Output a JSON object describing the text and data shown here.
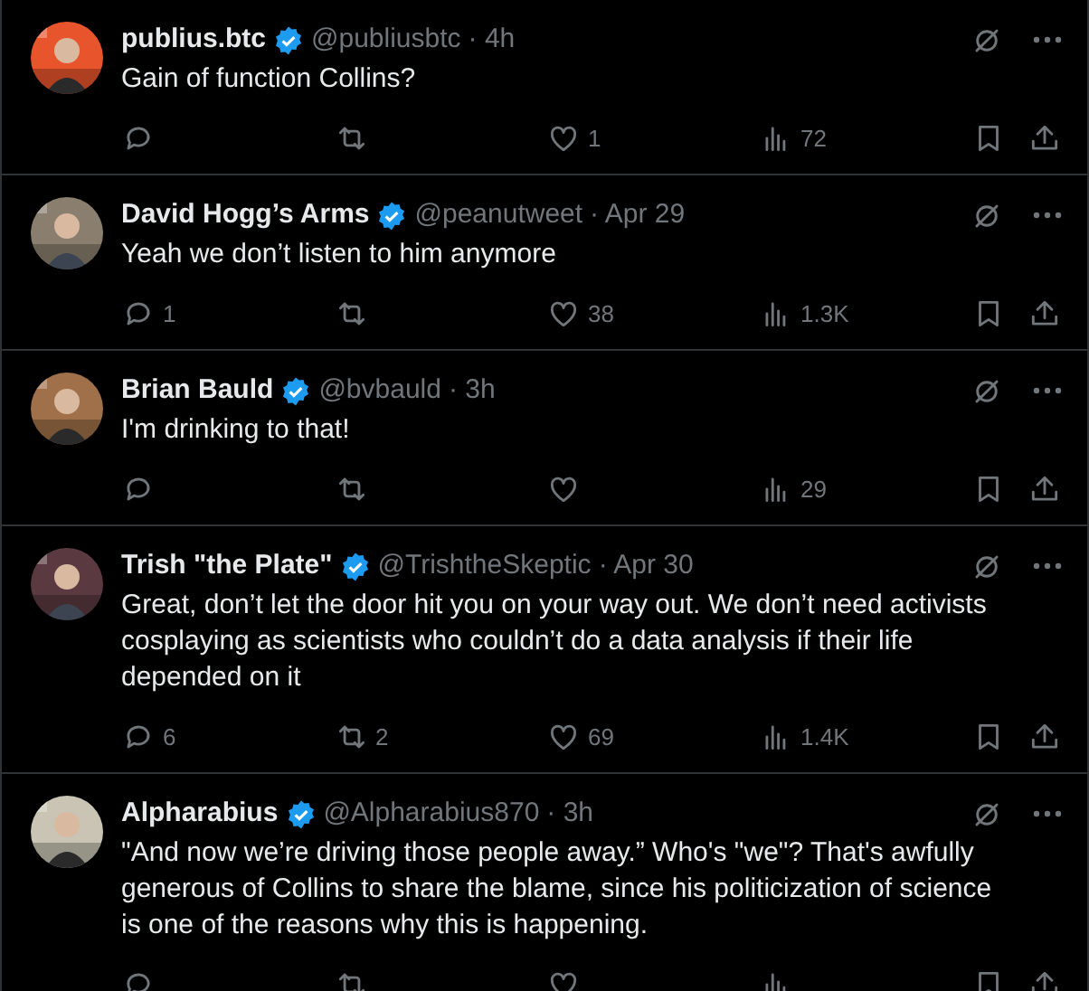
{
  "tweets": [
    {
      "name": "publius.btc",
      "verified": true,
      "handle": "@publiusbtc",
      "time": "· 4h",
      "text": "Gain of function Collins?",
      "likes": "1",
      "views": "72"
    },
    {
      "name": "David Hogg’s Arms",
      "verified": true,
      "handle": "@peanutweet",
      "time": "· Apr 29",
      "text": "Yeah we don’t listen to him anymore",
      "replies": "1",
      "likes": "38",
      "views": "1.3K"
    },
    {
      "name": "Brian Bauld",
      "verified": true,
      "handle": "@bvbauld",
      "time": "· 3h",
      "text": "I'm drinking to that!",
      "views": "29"
    },
    {
      "name": "Trish \"the Plate\"",
      "verified": true,
      "handle": "@TrishtheSkeptic",
      "time": "· Apr 30",
      "text": "Great, don’t let the door hit you on your way out. We don’t need activists cosplaying as scientists who couldn’t do a data analysis if their life depended on it",
      "replies": "6",
      "reposts": "2",
      "likes": "69",
      "views": "1.4K"
    },
    {
      "name": "Alpharabius",
      "verified": true,
      "handle": "@Alpharabius870",
      "time": "· 3h",
      "text": "\"And now we’re driving those people away.”  Who's \"we\"?  That's awfully generous of Collins to share the blame, since his politicization of science is one of the reasons why this is happening."
    }
  ]
}
